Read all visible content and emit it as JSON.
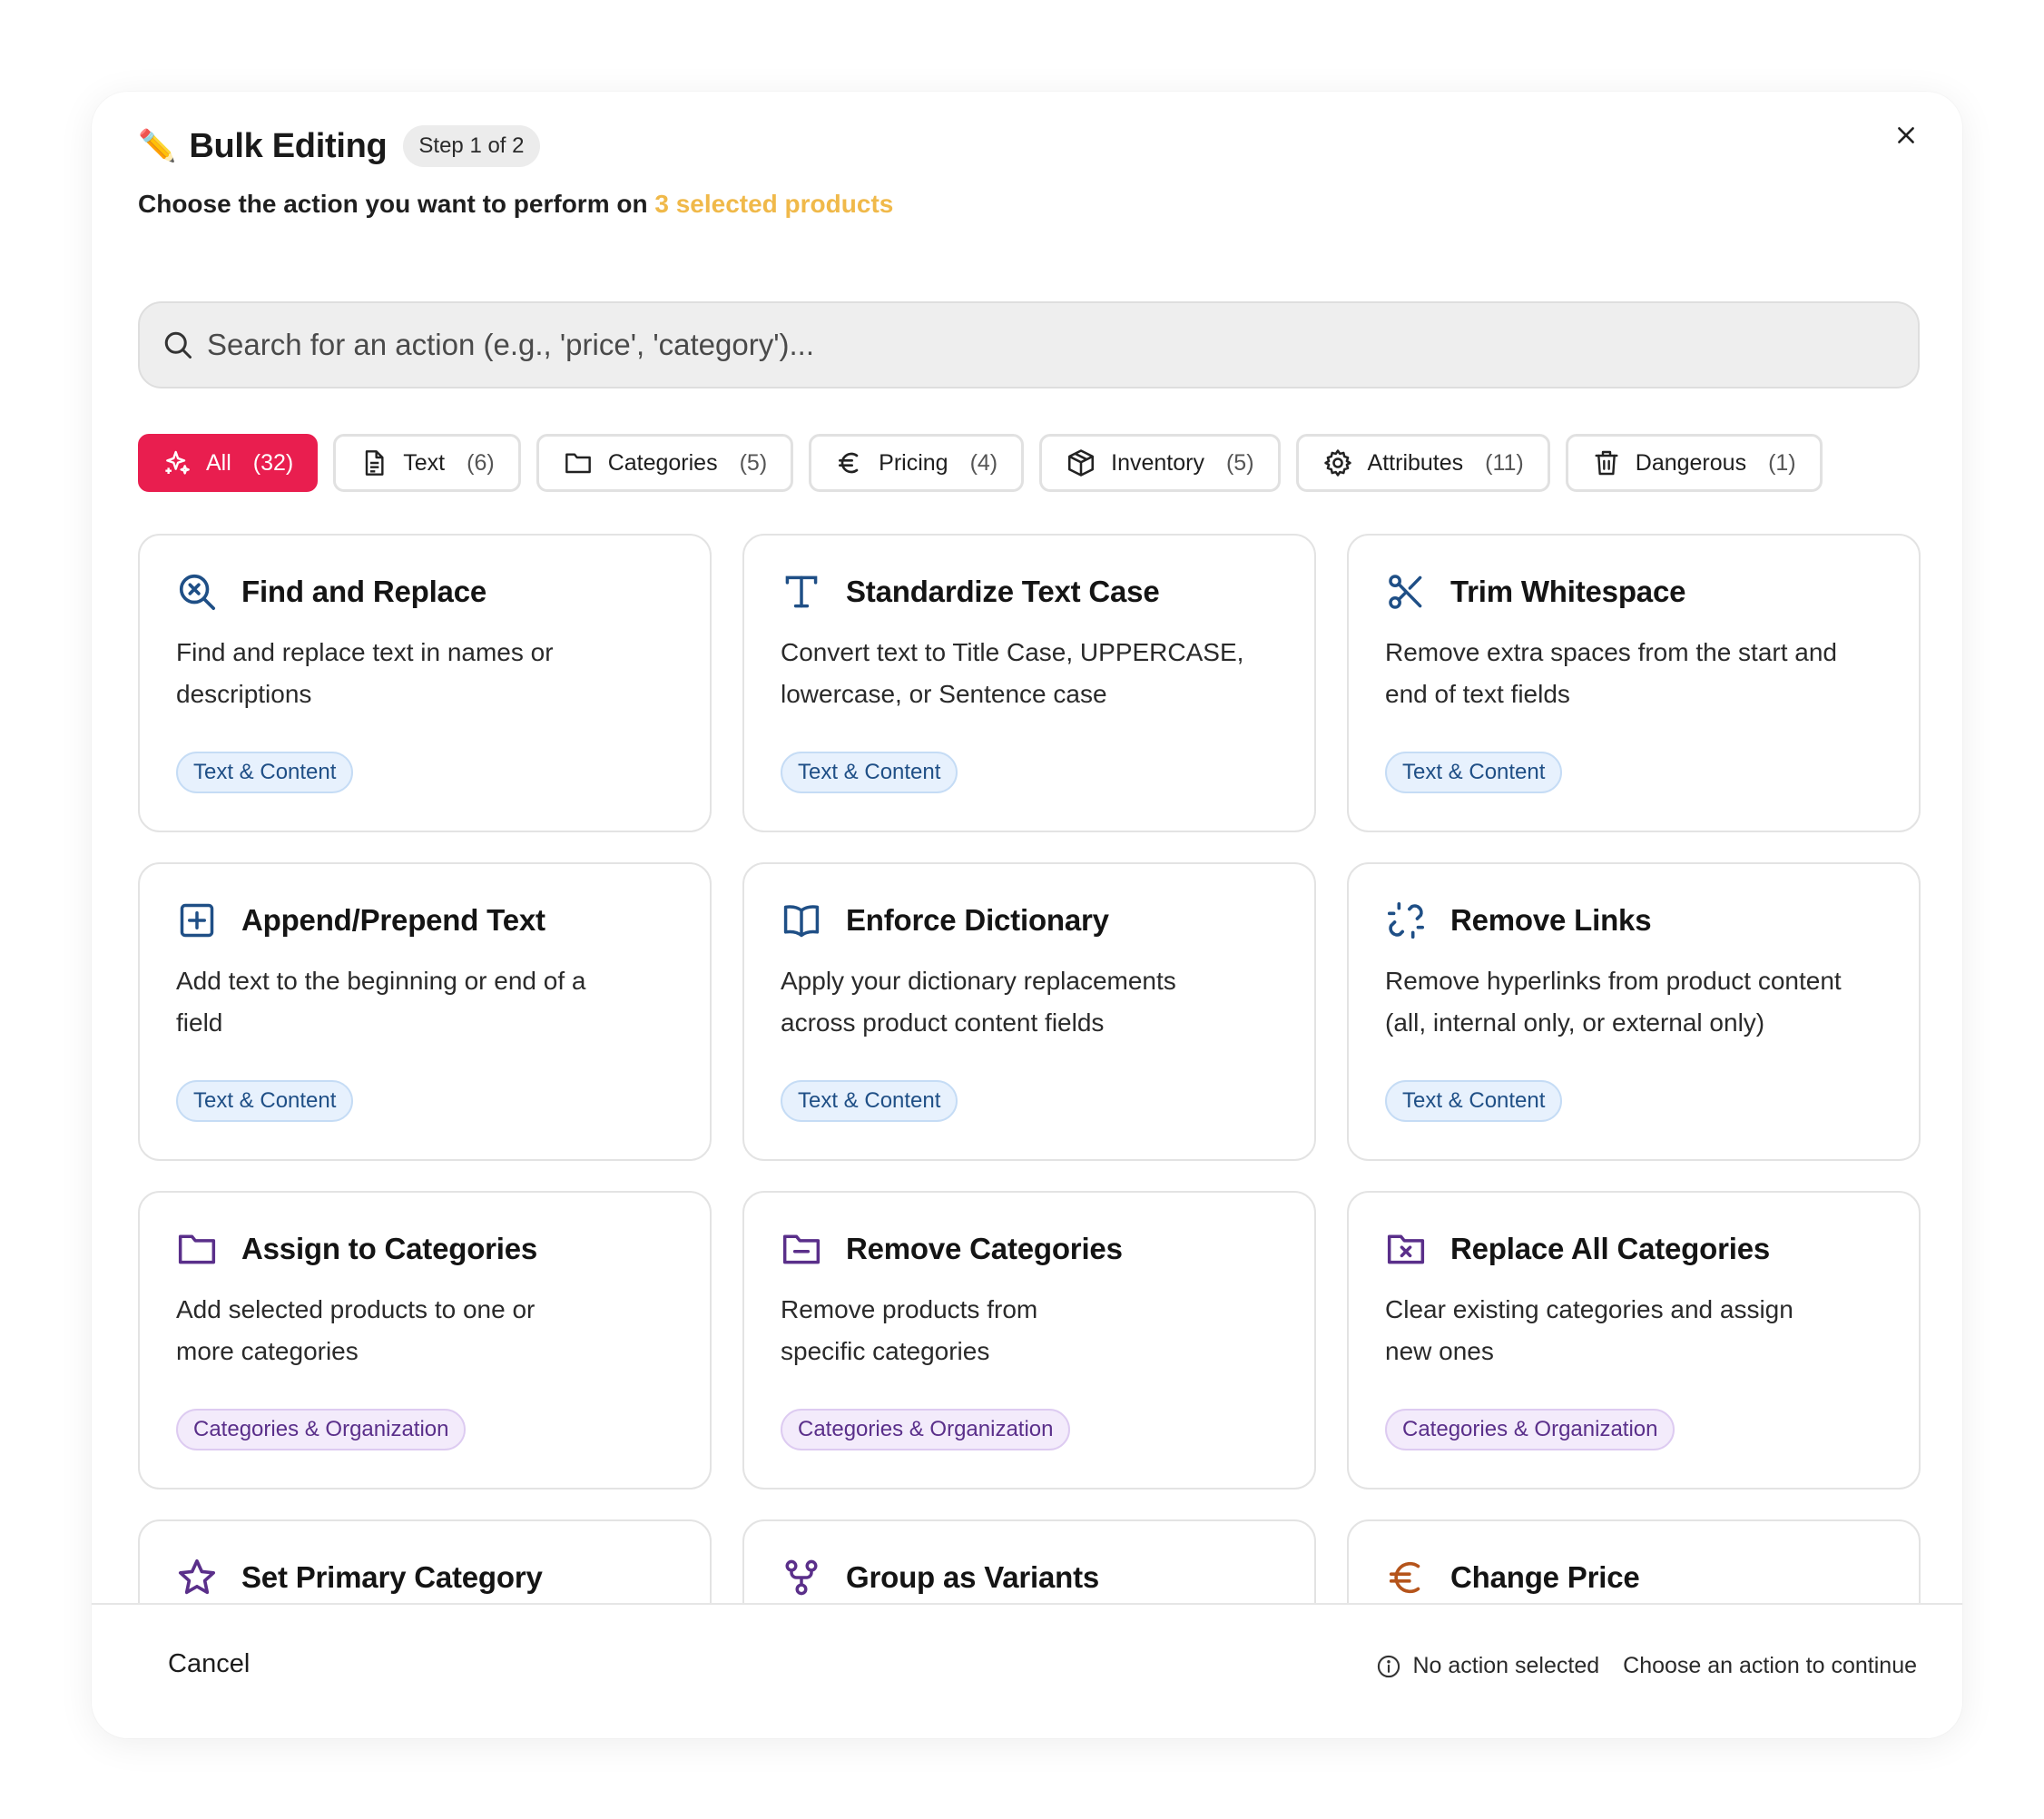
{
  "header": {
    "emoji": "✏️",
    "title": "Bulk Editing",
    "step": "Step 1 of 2",
    "subtitle_prefix": "Choose the action you want to perform on",
    "subtitle_highlight": "3 selected products",
    "highlight_color": "#f0b94a"
  },
  "search": {
    "placeholder": "Search for an action (e.g., 'price', 'category')...",
    "value": ""
  },
  "filters": [
    {
      "label": "All",
      "count": "(32)",
      "icon": "sparkles-icon",
      "active": true
    },
    {
      "label": "Text",
      "count": "(6)",
      "icon": "document-icon"
    },
    {
      "label": "Categories",
      "count": "(5)",
      "icon": "folder-icon"
    },
    {
      "label": "Pricing",
      "count": "(4)",
      "icon": "euro-icon"
    },
    {
      "label": "Inventory",
      "count": "(5)",
      "icon": "box-icon"
    },
    {
      "label": "Attributes",
      "count": "(11)",
      "icon": "gear-icon"
    },
    {
      "label": "Dangerous",
      "count": "(1)",
      "icon": "trash-icon"
    }
  ],
  "colors": {
    "accent": "#e91e4f",
    "text_icon": "#1f4f86",
    "category_icon": "#5a2f8a",
    "pricing_icon": "#b5541b"
  },
  "cards": [
    {
      "title": "Find and Replace",
      "desc": "Find and replace text in names or descriptions",
      "tag": "Text & Content",
      "icon": "search-replace-icon"
    },
    {
      "title": "Standardize Text Case",
      "desc": "Convert text to Title Case, UPPERCASE, lowercase, or Sentence case",
      "tag": "Text & Content",
      "icon": "text-case-icon"
    },
    {
      "title": "Trim Whitespace",
      "desc": "Remove extra spaces from the start and end of text fields",
      "tag": "Text & Content",
      "icon": "scissors-icon"
    },
    {
      "title": "Append/Prepend Text",
      "desc": "Add text to the beginning or end of a field",
      "tag": "Text & Content",
      "icon": "plus-square-icon"
    },
    {
      "title": "Enforce Dictionary",
      "desc": "Apply your dictionary replacements across product content fields",
      "tag": "Text & Content",
      "icon": "book-icon"
    },
    {
      "title": "Remove Links",
      "desc": "Remove hyperlinks from product content (all, internal only, or external only)",
      "tag": "Text & Content",
      "icon": "unlink-icon"
    },
    {
      "title": "Assign to Categories",
      "desc": "Add selected products to one or more categories",
      "tag": "Categories & Organization",
      "icon": "folder-icon"
    },
    {
      "title": "Remove Categories",
      "desc": "Remove products from specific categories",
      "tag": "Categories & Organization",
      "icon": "folder-minus-icon"
    },
    {
      "title": "Replace All Categories",
      "desc": "Clear existing categories and assign new ones",
      "tag": "Categories & Organization",
      "icon": "folder-x-icon"
    },
    {
      "title": "Set Primary Category",
      "desc": "",
      "tag": "",
      "icon": "star-icon"
    },
    {
      "title": "Group as Variants",
      "desc": "",
      "tag": "",
      "icon": "variants-icon"
    },
    {
      "title": "Change Price",
      "desc": "",
      "tag": "",
      "icon": "euro-icon"
    }
  ],
  "footer": {
    "cancel": "Cancel",
    "status": "No action selected",
    "hint": "Choose an action to continue"
  }
}
